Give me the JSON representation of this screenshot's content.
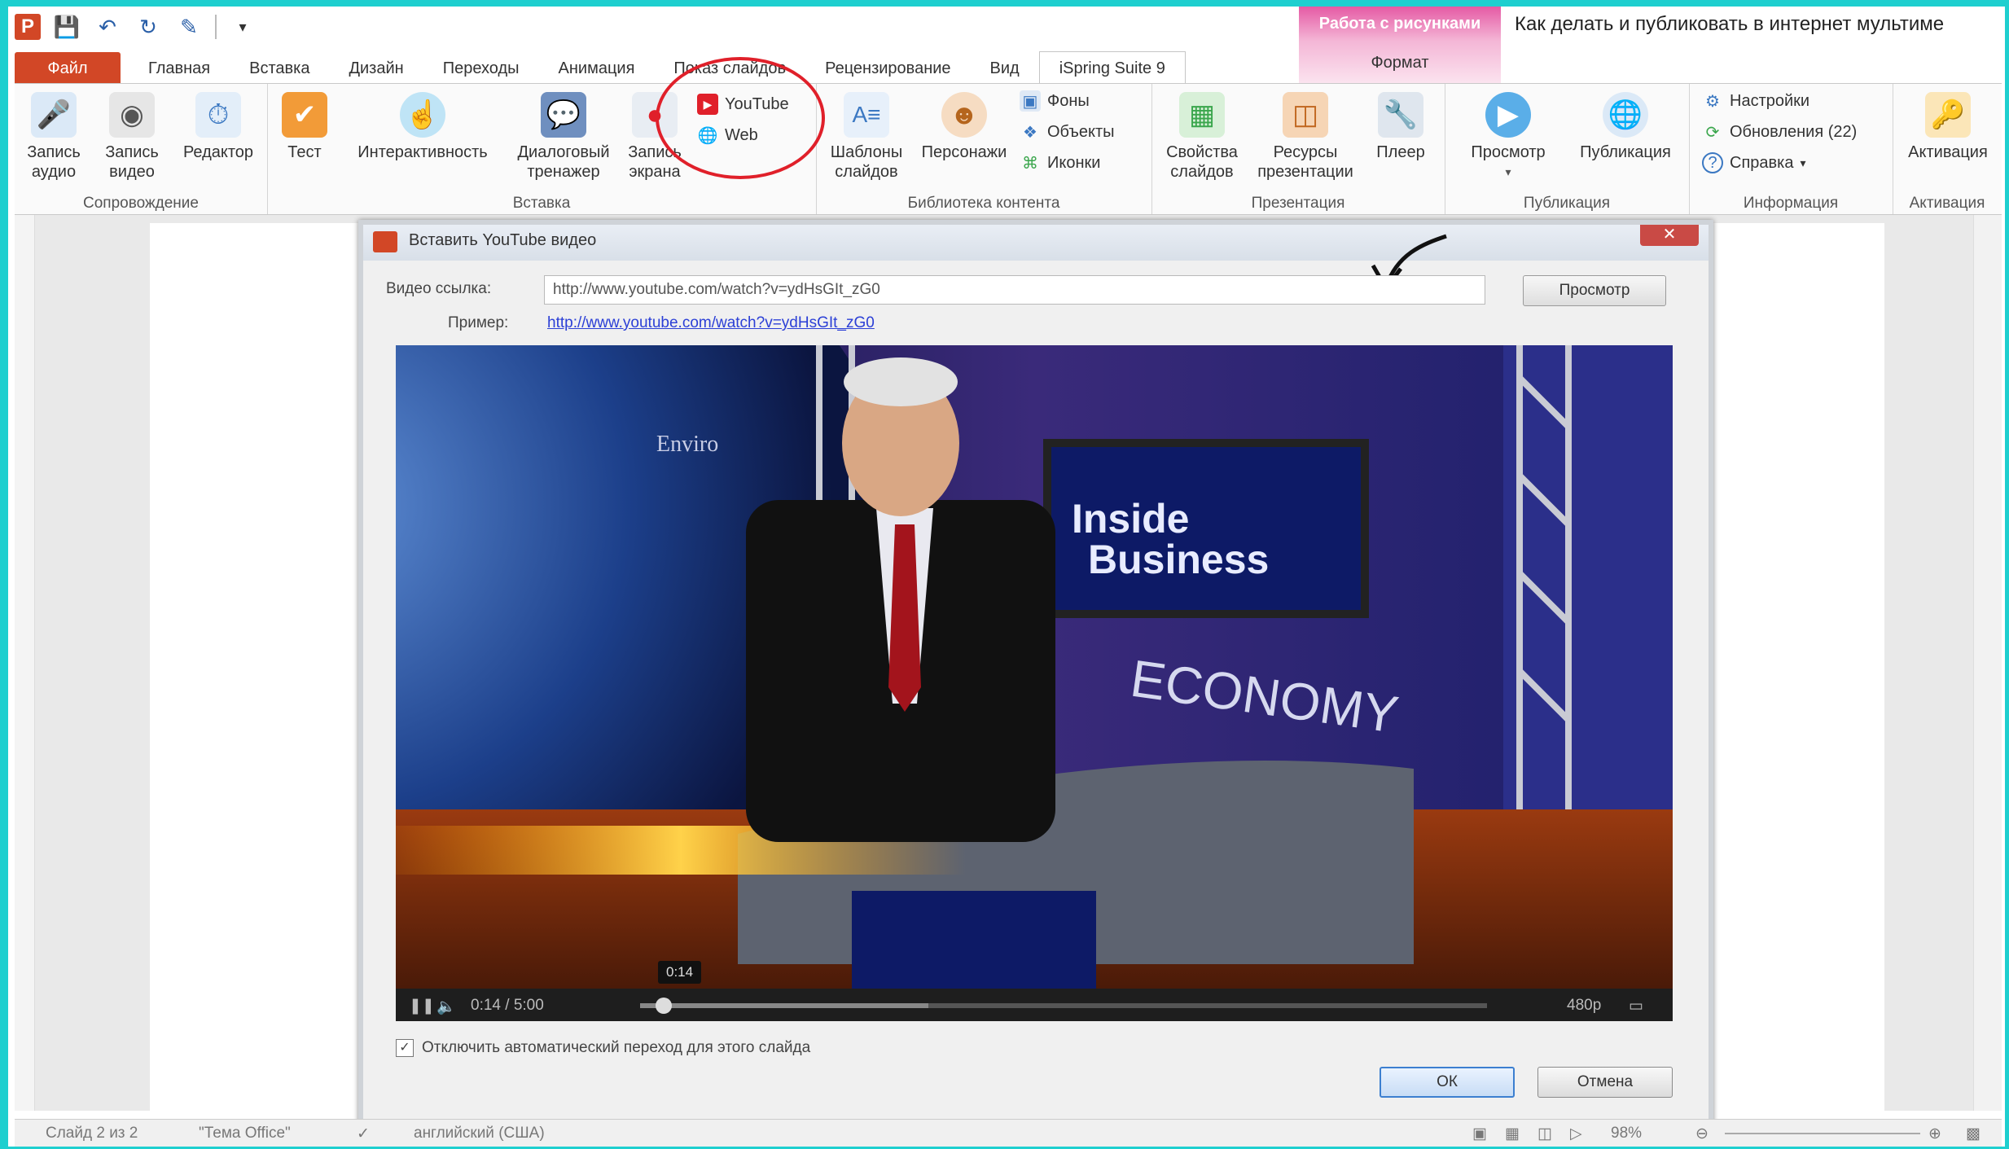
{
  "window_title": "Как делать и публиковать в интернет мультиме",
  "context_tab": {
    "title": "Работа с рисунками",
    "format_label": "Формат"
  },
  "tabs": [
    "Файл",
    "Главная",
    "Вставка",
    "Дизайн",
    "Переходы",
    "Анимация",
    "Показ слайдов",
    "Рецензирование",
    "Вид",
    "iSpring Suite 9"
  ],
  "ribbon": {
    "groups": {
      "narration": "Сопровождение",
      "insert": "Вставка",
      "library": "Библиотека контента",
      "presentation": "Презентация",
      "publish": "Публикация",
      "info": "Информация",
      "activation": "Активация"
    },
    "buttons": {
      "record_audio": "Запись аудио",
      "record_video": "Запись видео",
      "editor": "Редактор",
      "quiz": "Тест",
      "interactivity": "Интерактивность",
      "dialog_sim": "Диалоговый тренажер",
      "screen_record": "Запись экрана",
      "youtube": "YouTube",
      "web": "Web",
      "slide_templates": "Шаблоны слайдов",
      "characters": "Персонажи",
      "backgrounds": "Фоны",
      "objects": "Объекты",
      "icons": "Иконки",
      "slide_properties": "Свойства слайдов",
      "presentation_resources": "Ресурсы презентации",
      "player": "Плеер",
      "preview": "Просмотр",
      "publish": "Публикация",
      "settings": "Настройки",
      "updates": "Обновления (22)",
      "help": "Справка",
      "activation": "Активация"
    }
  },
  "dialog": {
    "title": "Вставить YouTube видео",
    "close": "✕",
    "video_link_label": "Видео ссылка:",
    "video_link_value": "http://www.youtube.com/watch?v=ydHsGIt_zG0",
    "example_label": "Пример:",
    "example_link": "http://www.youtube.com/watch?v=ydHsGIt_zG0",
    "preview_button": "Просмотр",
    "checkbox_label": "Отключить автоматический переход для этого слайда",
    "checkbox_checked": true,
    "ok": "ОК",
    "cancel": "Отмена",
    "player": {
      "time": "0:14 / 5:00",
      "tooltip": "0:14",
      "quality": "480p",
      "progress": 0.028
    },
    "video_text": {
      "inside": "Inside",
      "business": "Business",
      "economy": "ECONOMY",
      "enviro": "Enviro"
    }
  },
  "statusbar": {
    "slide": "Слайд 2 из 2",
    "theme": "\"Тема Office\"",
    "lang": "английский (США)",
    "zoom": "98%"
  },
  "colors": {
    "accent": "#d24726",
    "annotation": "#e0202a",
    "frame": "#1ecfcf"
  }
}
